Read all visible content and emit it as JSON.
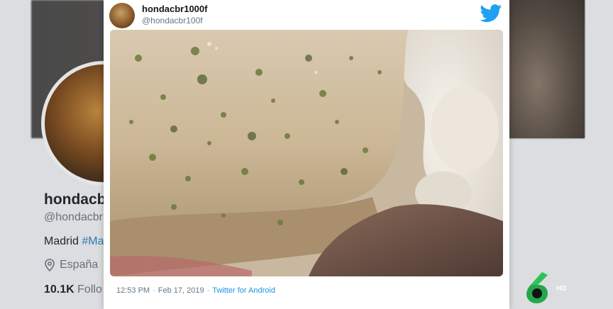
{
  "background_profile": {
    "name": "hondacbr",
    "handle": "@hondacbr",
    "bio_text": "Madrid",
    "bio_hashtag": "#Ma",
    "location": "España",
    "followers_count": "10.1K",
    "followers_label": "Follo"
  },
  "tweet": {
    "display_name": "hondacbr1000f",
    "handle": "@hondacbr100f",
    "time": "12:53 PM",
    "date": "Feb 17, 2019",
    "separator": "·",
    "source": "Twitter for Android"
  },
  "icons": {
    "brand": "twitter-bird-icon",
    "location": "location-pin-icon",
    "channel": "lasexta-logo-icon"
  },
  "overlay": {
    "hd_label": "HD"
  },
  "colors": {
    "twitter_blue": "#1da1f2",
    "link": "#1b95e0",
    "channel_green": "#22a84a"
  }
}
